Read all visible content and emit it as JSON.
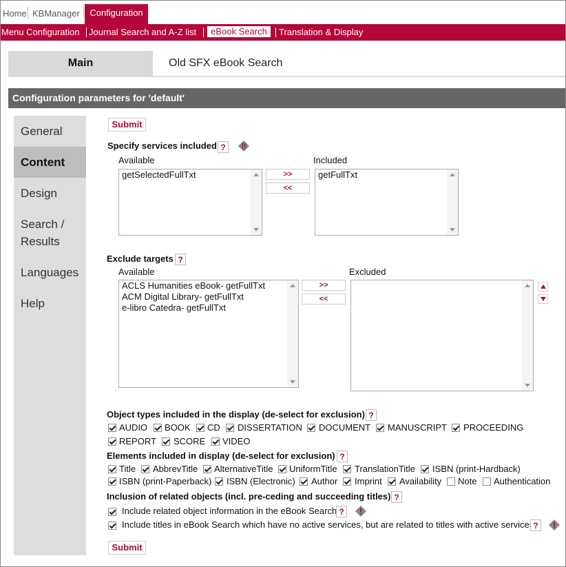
{
  "top_nav": {
    "home": "Home",
    "kbmanager": "KBManager",
    "configuration": "Configuration"
  },
  "sub_nav": {
    "menu_config": "Menu Configuration",
    "journal_search": "Journal Search and A-Z list",
    "ebook_search": "eBook Search",
    "translation": "Translation & Display"
  },
  "tabs": {
    "main": "Main",
    "old": "Old SFX eBook Search"
  },
  "config_header": "Configuration parameters for 'default'",
  "side_nav": [
    "General",
    "Content",
    "Design",
    "Search /",
    "Results",
    "Languages",
    "Help"
  ],
  "submit_label": "Submit",
  "services": {
    "title": "Specify services included",
    "available_label": "Available",
    "included_label": "Included",
    "available": [
      "getSelectedFullTxt"
    ],
    "included": [
      "getFullTxt"
    ],
    "add": ">>",
    "remove": "<<"
  },
  "targets": {
    "title": "Exclude targets",
    "available_label": "Available",
    "excluded_label": "Excluded",
    "available": [
      "ACLS Humanities eBook- getFullTxt",
      "ACM Digital Library- getFullTxt",
      "e-libro Catedra- getFullTxt"
    ],
    "add": ">>",
    "remove": "<<"
  },
  "object_types": {
    "title": "Object types included in the display (de-select for exclusion)",
    "items": [
      "AUDIO",
      "BOOK",
      "CD",
      "DISSERTATION",
      "DOCUMENT",
      "MANUSCRIPT",
      "PROCEEDING",
      "REPORT",
      "SCORE",
      "VIDEO"
    ]
  },
  "elements": {
    "title": "Elements included in display (de-select for exclusion)",
    "items": [
      "Title",
      "AbbrevTitle",
      "AlternativeTitle",
      "UniformTitle",
      "TranslationTitle",
      "ISBN (print-Hardback)",
      "ISBN (print-Paperback)",
      "ISBN (Electronic)",
      "Author",
      "Imprint",
      "Availability",
      "Note",
      "Authentication"
    ]
  },
  "related": {
    "title": "Inclusion of related objects (incl. pre-ceding and succeeding titles)",
    "opt1": "Include related object information in the eBook Search",
    "opt2": "Include titles in eBook Search which have no active services, but are related to titles with active services"
  },
  "help_glyph": "?",
  "warn_glyph": "!",
  "colors": {
    "brand": "#b5073c",
    "header_bar": "#666666",
    "side_nav": "#dddddd"
  }
}
